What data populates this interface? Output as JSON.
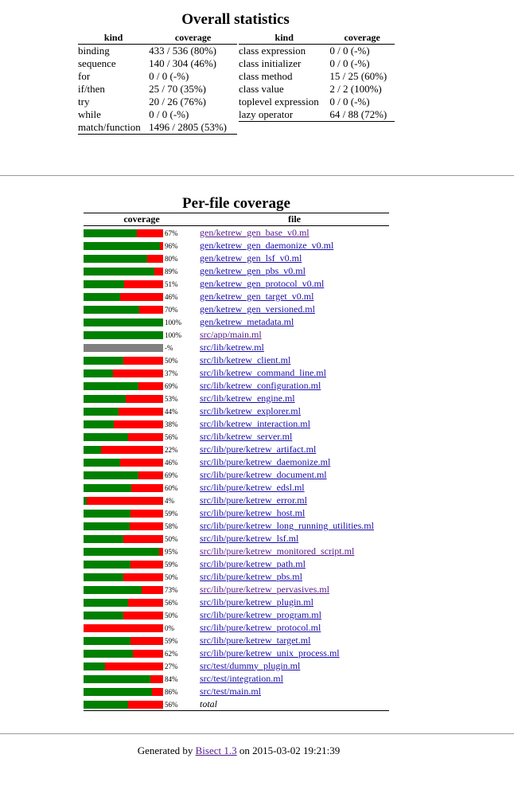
{
  "overall": {
    "title": "Overall statistics",
    "headers": {
      "kind": "kind",
      "coverage": "coverage"
    },
    "left": [
      {
        "kind": "binding",
        "coverage": "433 / 536 (80%)"
      },
      {
        "kind": "sequence",
        "coverage": "140 / 304 (46%)"
      },
      {
        "kind": "for",
        "coverage": "0 / 0 (-%)"
      },
      {
        "kind": "if/then",
        "coverage": "25 / 70 (35%)"
      },
      {
        "kind": "try",
        "coverage": "20 / 26 (76%)"
      },
      {
        "kind": "while",
        "coverage": "0 / 0 (-%)"
      },
      {
        "kind": "match/function",
        "coverage": "1496 / 2805 (53%)"
      }
    ],
    "right": [
      {
        "kind": "class expression",
        "coverage": "0 / 0 (-%)"
      },
      {
        "kind": "class initializer",
        "coverage": "0 / 0 (-%)"
      },
      {
        "kind": "class method",
        "coverage": "15 / 25 (60%)"
      },
      {
        "kind": "class value",
        "coverage": "2 / 2 (100%)"
      },
      {
        "kind": "toplevel expression",
        "coverage": "0 / 0 (-%)"
      },
      {
        "kind": "lazy operator",
        "coverage": "64 / 88 (72%)"
      }
    ]
  },
  "per_file": {
    "title": "Per-file coverage",
    "headers": {
      "coverage": "coverage",
      "file": "file"
    },
    "colors": {
      "covered": "#008000",
      "uncovered": "#ff0000",
      "na": "#808080"
    },
    "files": [
      {
        "pct": 67,
        "label": "67%",
        "file": "gen/ketrew_gen_base_v0.ml",
        "visited": true
      },
      {
        "pct": 96,
        "label": "96%",
        "file": "gen/ketrew_gen_daemonize_v0.ml",
        "visited": false
      },
      {
        "pct": 80,
        "label": "80%",
        "file": "gen/ketrew_gen_lsf_v0.ml",
        "visited": false
      },
      {
        "pct": 89,
        "label": "89%",
        "file": "gen/ketrew_gen_pbs_v0.ml",
        "visited": false
      },
      {
        "pct": 51,
        "label": "51%",
        "file": "gen/ketrew_gen_protocol_v0.ml",
        "visited": false
      },
      {
        "pct": 46,
        "label": "46%",
        "file": "gen/ketrew_gen_target_v0.ml",
        "visited": false
      },
      {
        "pct": 70,
        "label": "70%",
        "file": "gen/ketrew_gen_versioned.ml",
        "visited": false
      },
      {
        "pct": 100,
        "label": "100%",
        "file": "gen/ketrew_metadata.ml",
        "visited": false
      },
      {
        "pct": 100,
        "label": "100%",
        "file": "src/app/main.ml",
        "visited": true
      },
      {
        "pct": null,
        "label": "-%",
        "file": "src/lib/ketrew.ml",
        "visited": false
      },
      {
        "pct": 50,
        "label": "50%",
        "file": "src/lib/ketrew_client.ml",
        "visited": false
      },
      {
        "pct": 37,
        "label": "37%",
        "file": "src/lib/ketrew_command_line.ml",
        "visited": false
      },
      {
        "pct": 69,
        "label": "69%",
        "file": "src/lib/ketrew_configuration.ml",
        "visited": false
      },
      {
        "pct": 53,
        "label": "53%",
        "file": "src/lib/ketrew_engine.ml",
        "visited": false
      },
      {
        "pct": 44,
        "label": "44%",
        "file": "src/lib/ketrew_explorer.ml",
        "visited": false
      },
      {
        "pct": 38,
        "label": "38%",
        "file": "src/lib/ketrew_interaction.ml",
        "visited": false
      },
      {
        "pct": 56,
        "label": "56%",
        "file": "src/lib/ketrew_server.ml",
        "visited": false
      },
      {
        "pct": 22,
        "label": "22%",
        "file": "src/lib/pure/ketrew_artifact.ml",
        "visited": false
      },
      {
        "pct": 46,
        "label": "46%",
        "file": "src/lib/pure/ketrew_daemonize.ml",
        "visited": false
      },
      {
        "pct": 69,
        "label": "69%",
        "file": "src/lib/pure/ketrew_document.ml",
        "visited": false
      },
      {
        "pct": 60,
        "label": "60%",
        "file": "src/lib/pure/ketrew_edsl.ml",
        "visited": false
      },
      {
        "pct": 4,
        "label": "4%",
        "file": "src/lib/pure/ketrew_error.ml",
        "visited": false
      },
      {
        "pct": 59,
        "label": "59%",
        "file": "src/lib/pure/ketrew_host.ml",
        "visited": false
      },
      {
        "pct": 58,
        "label": "58%",
        "file": "src/lib/pure/ketrew_long_running_utilities.ml",
        "visited": false
      },
      {
        "pct": 50,
        "label": "50%",
        "file": "src/lib/pure/ketrew_lsf.ml",
        "visited": false
      },
      {
        "pct": 95,
        "label": "95%",
        "file": "src/lib/pure/ketrew_monitored_script.ml",
        "visited": true
      },
      {
        "pct": 59,
        "label": "59%",
        "file": "src/lib/pure/ketrew_path.ml",
        "visited": false
      },
      {
        "pct": 50,
        "label": "50%",
        "file": "src/lib/pure/ketrew_pbs.ml",
        "visited": false
      },
      {
        "pct": 73,
        "label": "73%",
        "file": "src/lib/pure/ketrew_pervasives.ml",
        "visited": true
      },
      {
        "pct": 56,
        "label": "56%",
        "file": "src/lib/pure/ketrew_plugin.ml",
        "visited": false
      },
      {
        "pct": 50,
        "label": "50%",
        "file": "src/lib/pure/ketrew_program.ml",
        "visited": false
      },
      {
        "pct": 0,
        "label": "0%",
        "file": "src/lib/pure/ketrew_protocol.ml",
        "visited": false
      },
      {
        "pct": 59,
        "label": "59%",
        "file": "src/lib/pure/ketrew_target.ml",
        "visited": false
      },
      {
        "pct": 62,
        "label": "62%",
        "file": "src/lib/pure/ketrew_unix_process.ml",
        "visited": false
      },
      {
        "pct": 27,
        "label": "27%",
        "file": "src/test/dummy_plugin.ml",
        "visited": false
      },
      {
        "pct": 84,
        "label": "84%",
        "file": "src/test/integration.ml",
        "visited": false
      },
      {
        "pct": 86,
        "label": "86%",
        "file": "src/test/main.ml",
        "visited": false
      }
    ],
    "total": {
      "pct": 56,
      "label": "56%",
      "name": "total"
    }
  },
  "footer": {
    "prefix": "Generated by ",
    "link": "Bisect 1.3",
    "suffix": " on 2015-03-02 19:21:39"
  }
}
